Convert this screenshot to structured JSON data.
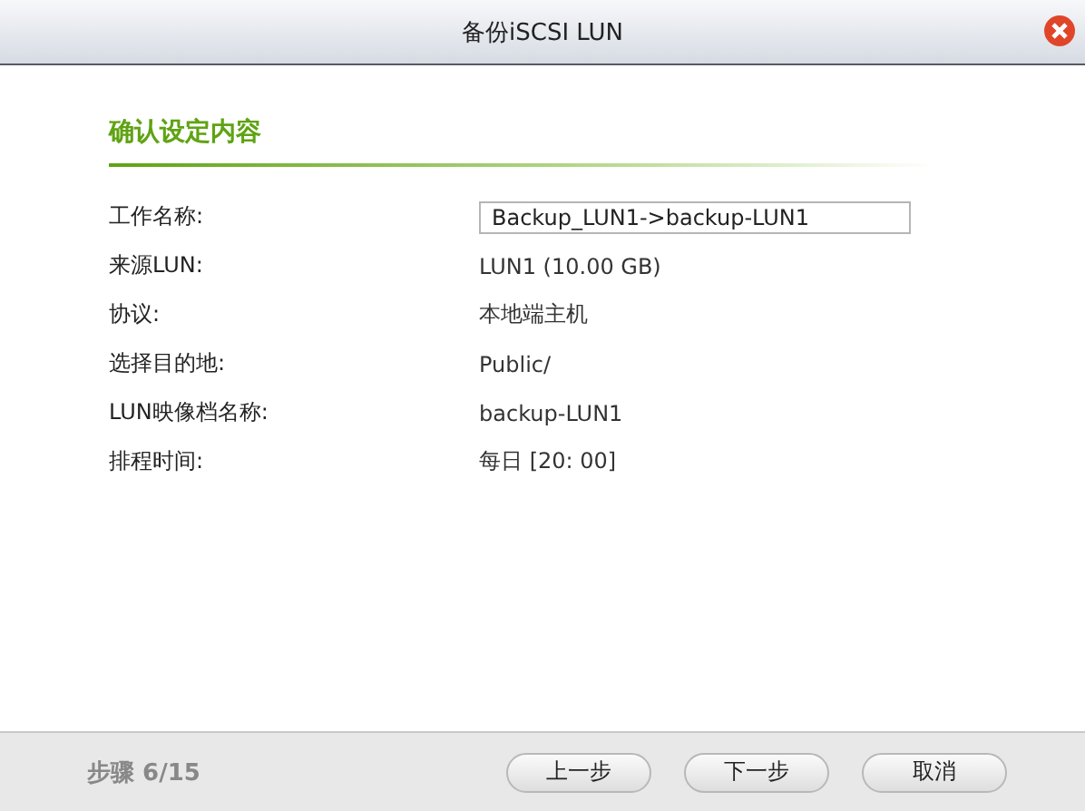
{
  "window": {
    "title": "备份iSCSI LUN"
  },
  "section": {
    "title": "确认设定内容"
  },
  "fields": [
    {
      "label": "工作名称:",
      "kind": "input",
      "value": "Backup_LUN1->backup-LUN1"
    },
    {
      "label": "来源LUN:",
      "kind": "text",
      "value": "LUN1 (10.00 GB)"
    },
    {
      "label": "协议:",
      "kind": "text",
      "value": "本地端主机"
    },
    {
      "label": "选择目的地:",
      "kind": "text",
      "value": "Public/"
    },
    {
      "label": "LUN映像档名称:",
      "kind": "text",
      "value": "backup-LUN1"
    },
    {
      "label": "排程时间:",
      "kind": "text",
      "value": "每日 [20: 00]"
    }
  ],
  "footer": {
    "step": "步骤 6/15",
    "buttons": [
      "上一步",
      "下一步",
      "取消"
    ]
  }
}
